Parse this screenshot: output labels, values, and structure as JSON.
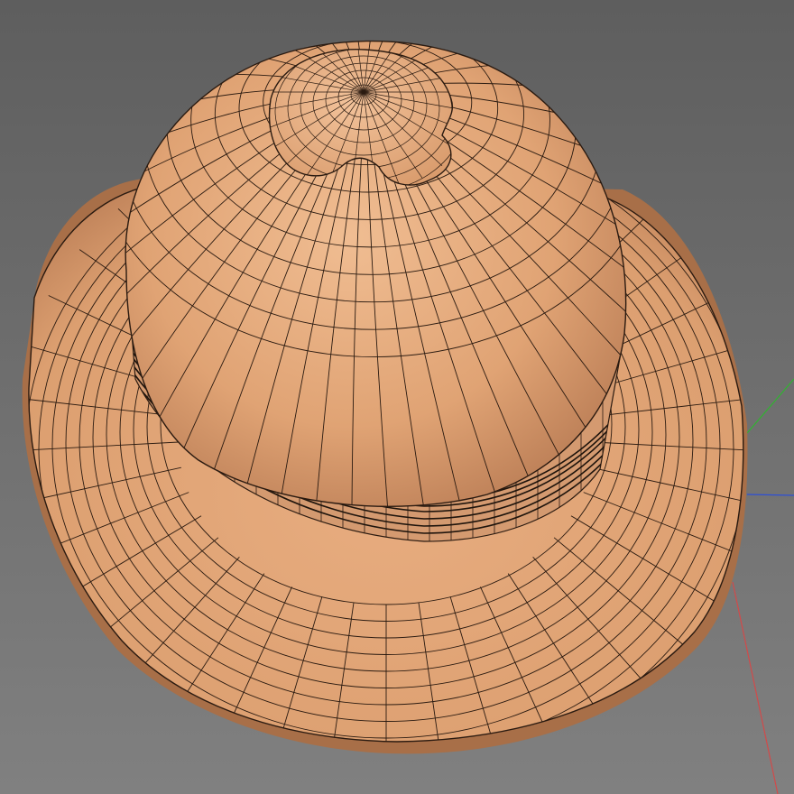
{
  "viewport": {
    "background_top": "#5e5e5e",
    "background_bottom": "#808080",
    "wire_color": "#2a1a10",
    "band_line_color": "#1e140c"
  },
  "model": {
    "object": "pith-helmet",
    "shading": "textured-wireframe",
    "base_color": "#e0a374",
    "highlight_color": "#f0bd92",
    "shadow_color": "#b77a53",
    "band_color": "#d49a70"
  },
  "axes": {
    "x_color": "#d24a4a",
    "y_color": "#2fb52f",
    "z_color": "#2d4fd6"
  }
}
